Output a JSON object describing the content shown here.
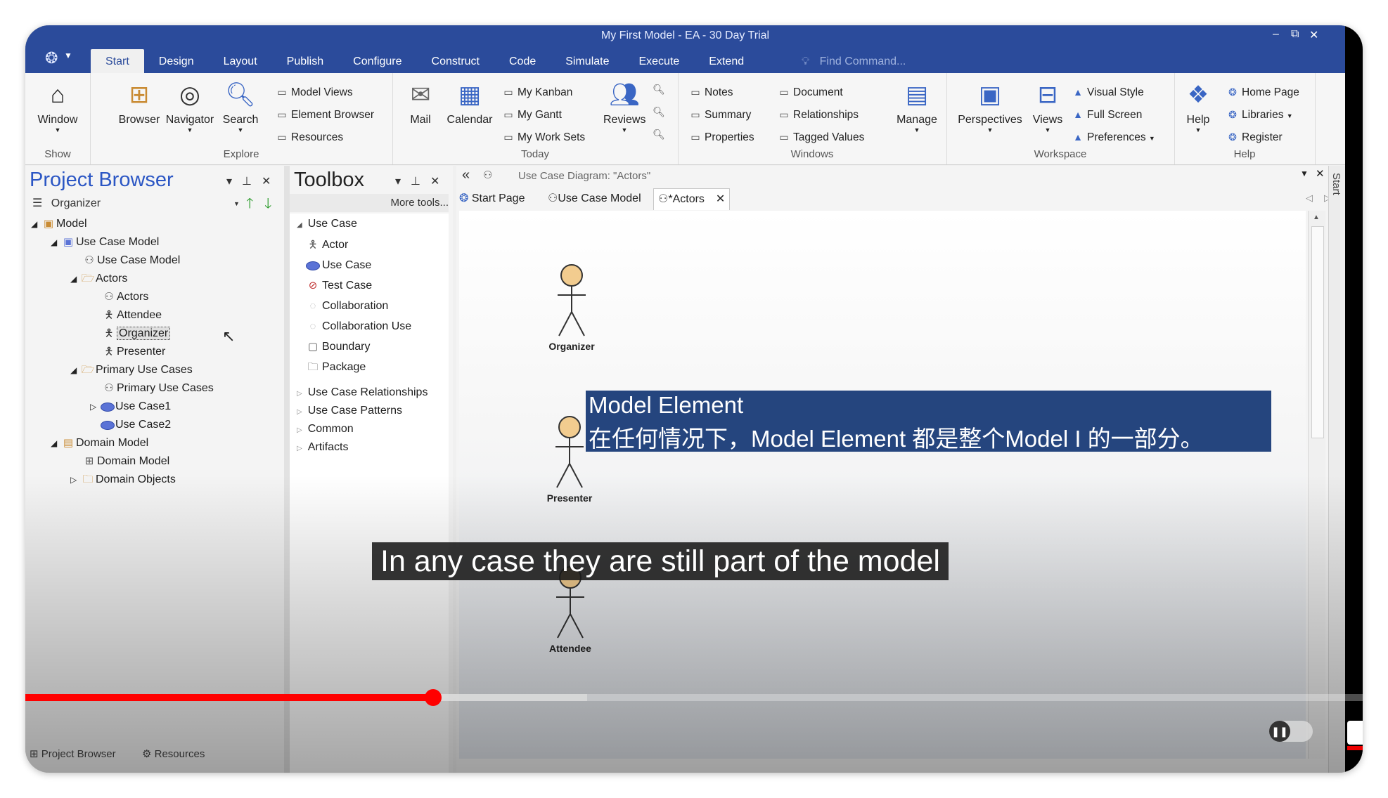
{
  "window": {
    "title": "My First Model - EA - 30 Day Trial",
    "controls": [
      "–",
      "⧉",
      "✕"
    ]
  },
  "menu": {
    "tabs": [
      "Start",
      "Design",
      "Layout",
      "Publish",
      "Configure",
      "Construct",
      "Code",
      "Simulate",
      "Execute",
      "Extend"
    ],
    "active": "Start",
    "find_placeholder": "Find Command..."
  },
  "ribbon": {
    "show": {
      "label": "Show",
      "window": "Window"
    },
    "explore": {
      "label": "Explore",
      "browser": "Browser",
      "navigator": "Navigator",
      "search": "Search",
      "model_views": "Model Views",
      "element_browser": "Element Browser",
      "resources": "Resources"
    },
    "today": {
      "label": "Today",
      "mail": "Mail",
      "calendar": "Calendar",
      "my_kanban": "My Kanban",
      "my_gantt": "My Gantt",
      "my_work_sets": "My Work Sets",
      "reviews": "Reviews"
    },
    "windows": {
      "label": "Windows",
      "notes": "Notes",
      "summary": "Summary",
      "properties": "Properties",
      "document": "Document",
      "relationships": "Relationships",
      "tagged_values": "Tagged Values",
      "manage": "Manage"
    },
    "workspace": {
      "label": "Workspace",
      "perspectives": "Perspectives",
      "views": "Views",
      "visual_style": "Visual Style",
      "full_screen": "Full Screen",
      "preferences": "Preferences"
    },
    "help": {
      "label": "Help",
      "help": "Help",
      "home_page": "Home Page",
      "libraries": "Libraries",
      "register": "Register"
    }
  },
  "project_browser": {
    "title": "Project Browser",
    "organizer": "Organizer",
    "tree": [
      {
        "label": "Model"
      },
      {
        "label": "Use Case Model"
      },
      {
        "label": "Use Case Model"
      },
      {
        "label": "Actors"
      },
      {
        "label": "Actors"
      },
      {
        "label": "Attendee"
      },
      {
        "label": "Organizer"
      },
      {
        "label": "Presenter"
      },
      {
        "label": "Primary Use Cases"
      },
      {
        "label": "Primary Use Cases"
      },
      {
        "label": "Use Case1"
      },
      {
        "label": "Use Case2"
      },
      {
        "label": "Domain Model"
      },
      {
        "label": "Domain Model"
      },
      {
        "label": "Domain Objects"
      }
    ],
    "bottom_tabs": [
      "Project Browser",
      "Resources"
    ]
  },
  "toolbox": {
    "title": "Toolbox",
    "more_tools": "More tools...",
    "section": "Use Case",
    "items": [
      "Actor",
      "Use Case",
      "Test Case",
      "Collaboration",
      "Collaboration Use",
      "Boundary",
      "Package"
    ],
    "groups": [
      "Use Case Relationships",
      "Use Case Patterns",
      "Common",
      "Artifacts"
    ]
  },
  "diagram": {
    "header": "Use Case Diagram: \"Actors\"",
    "tabs": [
      "Start Page",
      "Use Case Model",
      "*Actors"
    ],
    "actors": [
      "Organizer",
      "Presenter",
      "Attendee"
    ],
    "side_strip": "Start"
  },
  "overlay": {
    "line1": "Model Element",
    "line2": "在任何情况下，Model Element 都是整个Model I 的一部分。"
  },
  "video": {
    "subtitle": "In any case they are still part of the model",
    "progress_fraction": 0.305,
    "buffered_fraction": 0.42,
    "accent_color": "#ff0000"
  }
}
